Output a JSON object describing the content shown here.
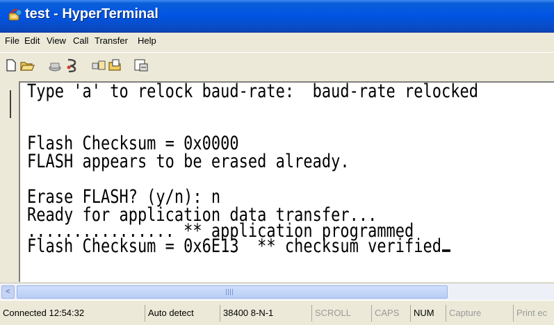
{
  "window": {
    "title": "test - HyperTerminal",
    "icon": "hyperterminal-app-icon"
  },
  "menu": [
    "File",
    "Edit",
    "View",
    "Call",
    "Transfer",
    "Help"
  ],
  "toolbar": {
    "buttons": [
      {
        "name": "new-connection-icon"
      },
      {
        "name": "open-icon"
      },
      {
        "name": "connect-icon"
      },
      {
        "name": "disconnect-icon"
      },
      {
        "name": "send-icon"
      },
      {
        "name": "receive-icon"
      },
      {
        "name": "properties-icon"
      }
    ]
  },
  "terminal": {
    "lines": [
      "Type 'a' to relock baud-rate:  baud-rate relocked",
      "",
      "",
      "Flash Checksum = 0x0000",
      "FLASH appears to be erased already.",
      "",
      "Erase FLASH? (y/n): n",
      "Ready for application data transfer...",
      "................ ** application programmed",
      "Flash Checksum = 0x6E13  ** checksum verified"
    ]
  },
  "scrollbar": {
    "left_arrow": "<"
  },
  "status": {
    "connected": "Connected 12:54:32",
    "detect": "Auto detect",
    "settings": "38400 8-N-1",
    "scroll": "SCROLL",
    "caps": "CAPS",
    "num": "NUM",
    "capture": "Capture",
    "print_echo": "Print ec"
  },
  "colors": {
    "titlebar": "#0054e3",
    "chrome": "#ece9d8",
    "terminal_bg": "#ffffff"
  }
}
